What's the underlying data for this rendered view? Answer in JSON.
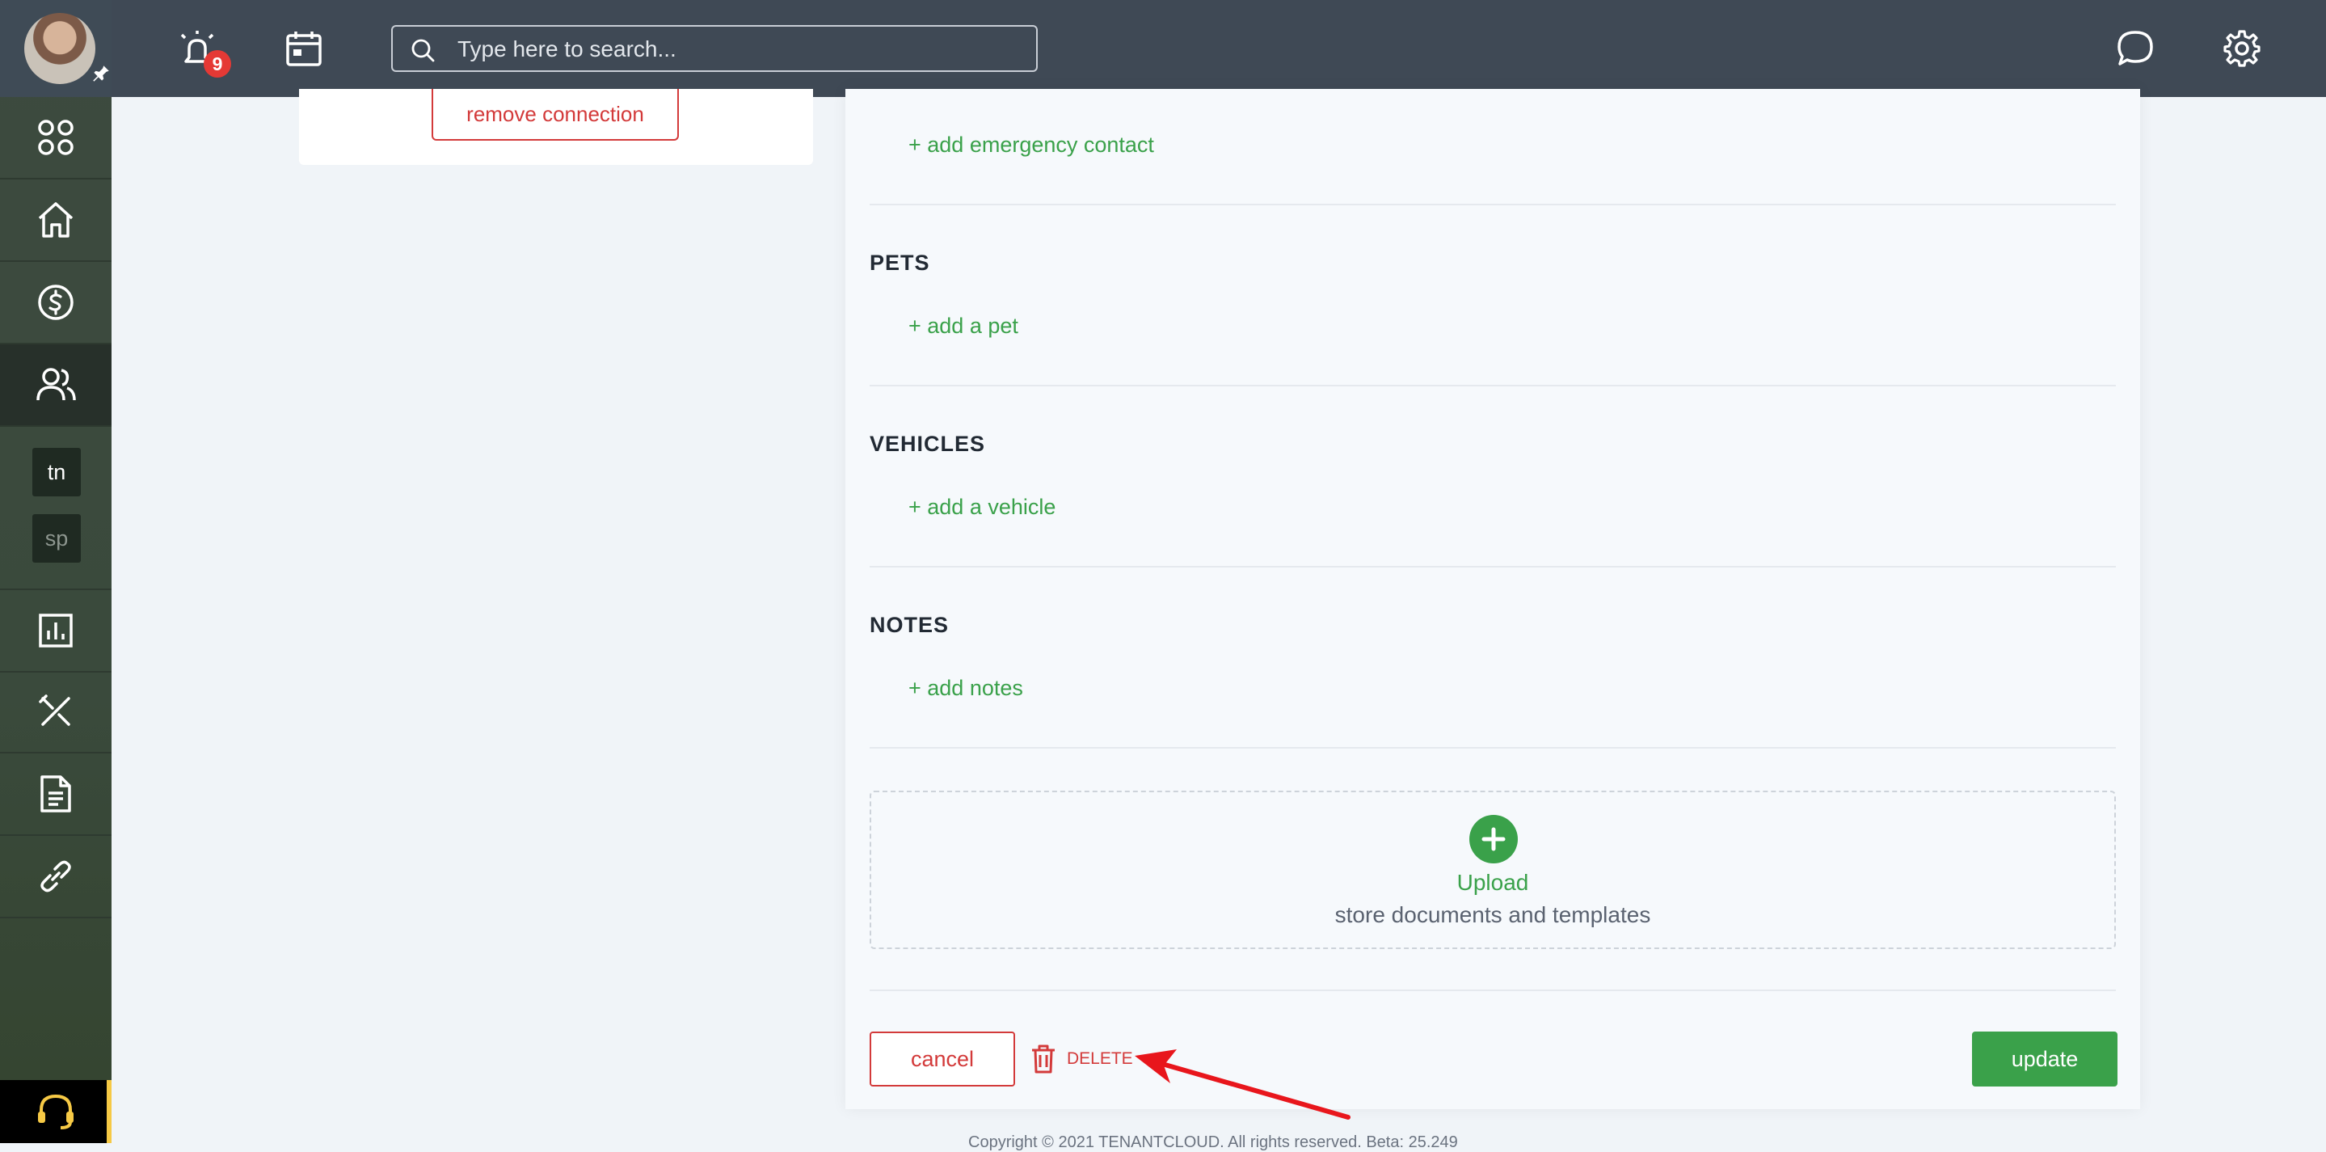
{
  "topbar": {
    "notification_count": "9",
    "search_placeholder": "Type here to search..."
  },
  "sidebar": {
    "tags": [
      "tn",
      "sp"
    ]
  },
  "left_panel": {
    "remove_connection_label": "remove connection"
  },
  "main": {
    "emergency_contact_link": "+ add emergency contact",
    "sections": [
      {
        "title": "PETS",
        "link": "+ add a pet"
      },
      {
        "title": "VEHICLES",
        "link": "+ add a vehicle"
      },
      {
        "title": "NOTES",
        "link": "+ add notes"
      }
    ],
    "upload": {
      "label": "Upload",
      "sub": "store documents and templates"
    },
    "actions": {
      "cancel": "cancel",
      "delete": "DELETE",
      "update": "update"
    }
  },
  "footer": {
    "copyright": "Copyright © 2021 TENANTCLOUD. All rights reserved. Beta: 25.249"
  },
  "colors": {
    "accent_green": "#3aa14a",
    "danger_red": "#d33a3a",
    "topbar": "#3f4955",
    "sidebar": "#3d4a3f",
    "annotation_arrow": "#e8161c"
  }
}
